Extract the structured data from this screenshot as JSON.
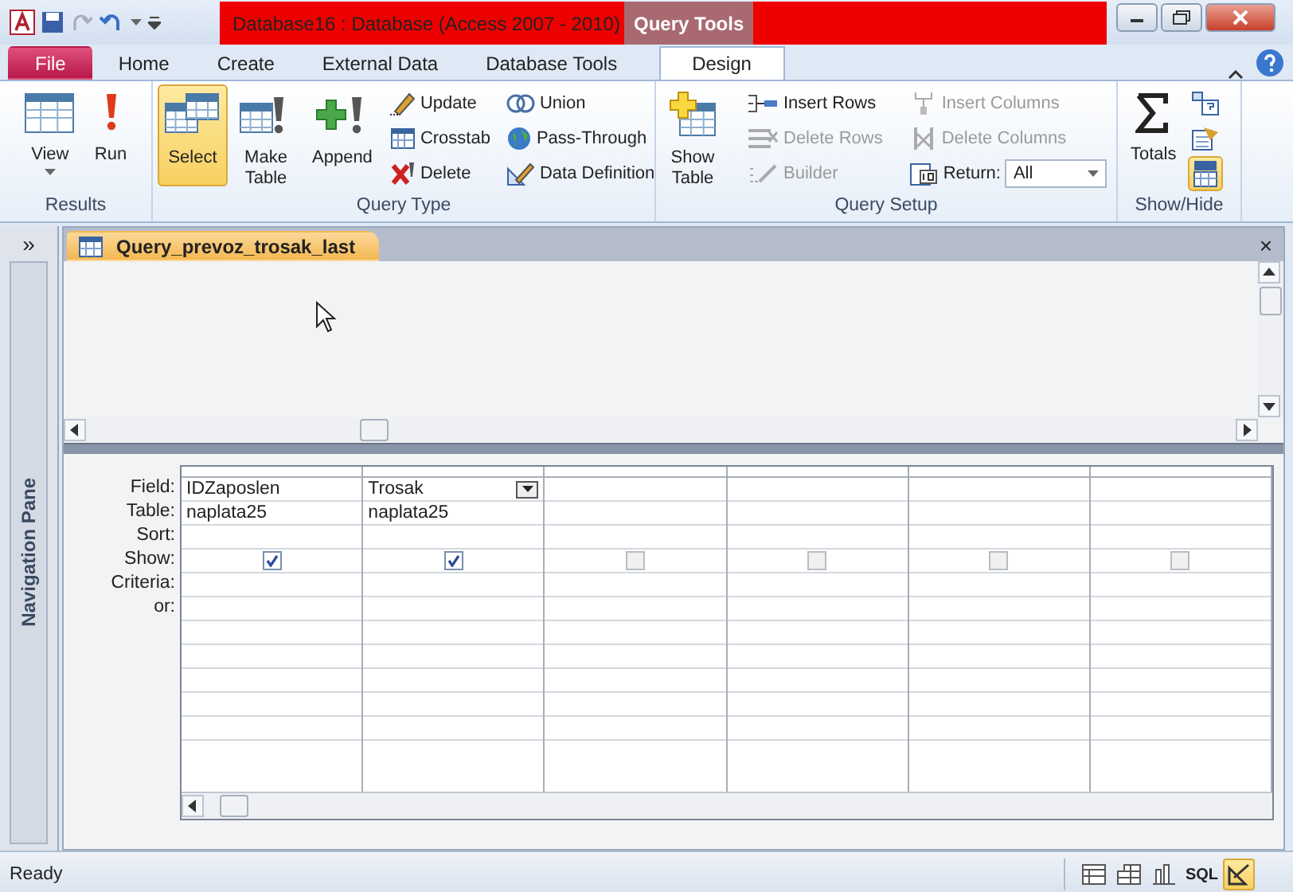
{
  "window": {
    "title": "Database16 : Database (Access 2007 - 2010)",
    "context_tab": "Query Tools"
  },
  "tabs": [
    {
      "label": "File",
      "kind": "file",
      "selected": false
    },
    {
      "label": "Home",
      "kind": "tab",
      "selected": false
    },
    {
      "label": "Create",
      "kind": "tab",
      "selected": false
    },
    {
      "label": "External Data",
      "kind": "tab",
      "selected": false
    },
    {
      "label": "Database Tools",
      "kind": "tab",
      "selected": false
    },
    {
      "label": "Design",
      "kind": "tab",
      "selected": true
    }
  ],
  "ribbon": {
    "results": {
      "label": "Results",
      "items": [
        {
          "label": "View",
          "dropdown": true,
          "selected": false
        },
        {
          "label": "Run",
          "dropdown": false,
          "selected": false
        }
      ]
    },
    "query_type": {
      "label": "Query Type",
      "large": [
        {
          "label": "Select",
          "selected": true
        },
        {
          "label": "Make Table",
          "selected": false
        },
        {
          "label": "Append",
          "selected": false
        }
      ],
      "small": [
        {
          "label": "Update"
        },
        {
          "label": "Crosstab"
        },
        {
          "label": "Delete"
        },
        {
          "label": "Union"
        },
        {
          "label": "Pass-Through"
        },
        {
          "label": "Data Definition"
        }
      ]
    },
    "query_setup": {
      "label": "Query Setup",
      "show_table": {
        "label": "Show Table"
      },
      "small": [
        {
          "label": "Insert Rows",
          "disabled": false
        },
        {
          "label": "Delete Rows",
          "disabled": true
        },
        {
          "label": "Builder",
          "disabled": true
        },
        {
          "label": "Insert Columns",
          "disabled": true
        },
        {
          "label": "Delete Columns",
          "disabled": true
        }
      ],
      "return": {
        "label": "Return:",
        "value": "All"
      }
    },
    "show_hide": {
      "label": "Show/Hide",
      "totals": {
        "label": "Totals",
        "selected": false
      },
      "toggles": [
        {
          "selected": false
        },
        {
          "selected": false
        },
        {
          "selected": true
        }
      ]
    }
  },
  "nav_pane": {
    "label": "Navigation Pane",
    "toggle": "»"
  },
  "document": {
    "tab": "Query_prevoz_trosak_last",
    "close": "×"
  },
  "grid": {
    "row_labels": [
      "Field:",
      "Table:",
      "Sort:",
      "Show:",
      "Criteria:",
      "or:"
    ],
    "columns": [
      {
        "field": "IDZaposlen",
        "table": "naplata25",
        "show": true,
        "focused": false
      },
      {
        "field": "Trosak",
        "table": "naplata25",
        "show": true,
        "focused": true
      },
      {
        "show": false,
        "focused": false
      },
      {
        "show": false,
        "focused": false
      },
      {
        "show": false,
        "focused": false
      },
      {
        "show": false,
        "focused": false
      }
    ]
  },
  "status_bar": {
    "text": "Ready",
    "views": [
      {
        "kind": "datasheet",
        "selected": false
      },
      {
        "kind": "pivottable",
        "selected": false
      },
      {
        "kind": "pivotchart",
        "selected": false
      },
      {
        "kind": "sql",
        "label": "SQL",
        "selected": false
      },
      {
        "kind": "design",
        "selected": true
      }
    ]
  }
}
